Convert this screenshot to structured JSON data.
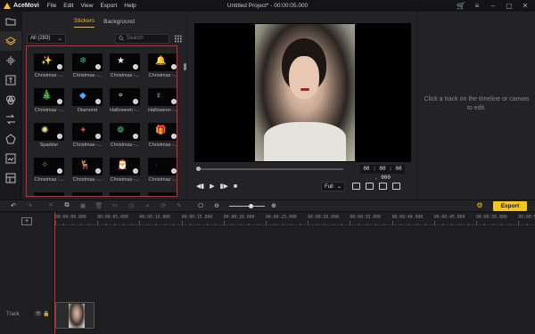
{
  "app": {
    "name": "AceMovi",
    "menu": [
      "File",
      "Edit",
      "View",
      "Export",
      "Help"
    ],
    "document_title": "Untitled Project* - 00:00:05.000"
  },
  "rail": {
    "items": [
      "folder-icon",
      "layers-icon",
      "audio-icon",
      "text-icon",
      "filter-icon",
      "transition-icon",
      "element-icon",
      "sticker-icon",
      "template-icon"
    ]
  },
  "media": {
    "tabs": [
      "Stickers",
      "Background"
    ],
    "active_tab": "Stickers",
    "category": "All (283)",
    "search_placeholder": "Search",
    "stickers": [
      {
        "label": "Christmas -...",
        "glyph": "✨",
        "color": "#f0b429"
      },
      {
        "label": "Christmas -...",
        "glyph": "❄",
        "color": "#3cb371"
      },
      {
        "label": "Christmas -...",
        "glyph": "★",
        "color": "#f0f0f0"
      },
      {
        "label": "Christmas -...",
        "glyph": "🔔",
        "color": "#e24040"
      },
      {
        "label": "Christmas -...",
        "glyph": "🎄",
        "color": "#2e8b57"
      },
      {
        "label": "Diamond",
        "glyph": "◆",
        "color": "#4da6ff"
      },
      {
        "label": "Halloween -...",
        "glyph": "⚬",
        "color": "#e0e0e0"
      },
      {
        "label": "Halloween -...",
        "glyph": "♀",
        "color": "#e0e0e0"
      },
      {
        "label": "Sparkler",
        "glyph": "✺",
        "color": "#f0e68c"
      },
      {
        "label": "Christmas -...",
        "glyph": "✦",
        "color": "#e24040"
      },
      {
        "label": "Christmas -...",
        "glyph": "❁",
        "color": "#3cb371"
      },
      {
        "label": "Christmas -...",
        "glyph": "🎁",
        "color": "#e24040"
      },
      {
        "label": "Christmas -...",
        "glyph": "✧",
        "color": "#888"
      },
      {
        "label": "Christmas -...",
        "glyph": "🦌",
        "color": "#e24040"
      },
      {
        "label": "Christmas -...",
        "glyph": "🎅",
        "color": "#e24040"
      },
      {
        "label": "Christmas -...",
        "glyph": "·",
        "color": "#666"
      },
      {
        "label": "",
        "glyph": "▲",
        "color": "#f0b429"
      },
      {
        "label": "",
        "glyph": "▪",
        "color": "#e24040"
      },
      {
        "label": "",
        "glyph": "▪",
        "color": "#e24040"
      },
      {
        "label": "",
        "glyph": "▪",
        "color": "#e24040"
      }
    ]
  },
  "preview": {
    "timecode": "00 : 00 : 00 . 000",
    "quality": "Full"
  },
  "properties": {
    "hint": "Click a track on the timeline or canvas to edit."
  },
  "toolbar": {
    "export_label": "Export"
  },
  "timeline": {
    "ruler": [
      "00:00:00.000",
      "00:00:05.000",
      "00:00:10.000",
      "00:00:15.000",
      "00:00:20.000",
      "00:00:25.000",
      "00:00:30.000",
      "00:00:35.000",
      "00:00:40.000",
      "00:00:45.000",
      "00:00:50.000",
      "00:00:55.000"
    ],
    "track_label": "Track"
  },
  "colors": {
    "accent": "#f5c518",
    "highlight_border": "#d9262e",
    "playhead": "#d9262e"
  }
}
